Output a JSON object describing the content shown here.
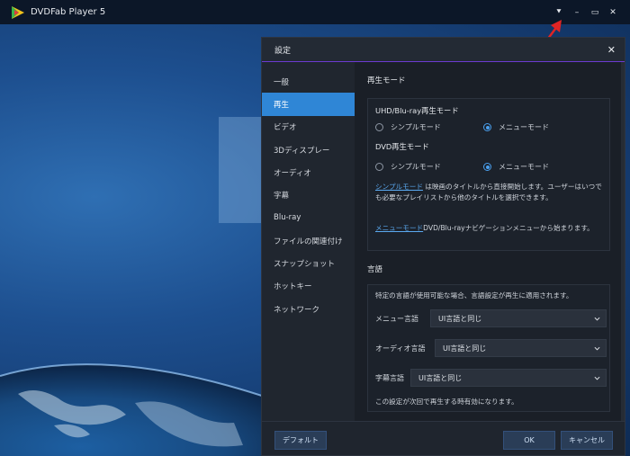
{
  "app": {
    "title": "DVDFab Player 5"
  },
  "window_controls": {
    "menu": "⯆",
    "minimize": "–",
    "maximize": "▭",
    "close": "✕"
  },
  "dialog": {
    "title": "設定",
    "close": "✕",
    "nav": [
      {
        "label": "一般"
      },
      {
        "label": "再生"
      },
      {
        "label": "ビデオ"
      },
      {
        "label": "3Dディスプレー"
      },
      {
        "label": "オーディオ"
      },
      {
        "label": "字幕"
      },
      {
        "label": "Blu-ray"
      },
      {
        "label": "ファイルの関連付け"
      },
      {
        "label": "スナップショット"
      },
      {
        "label": "ホットキー"
      },
      {
        "label": "ネットワーク"
      }
    ],
    "active_nav": "再生",
    "playback_mode": {
      "title": "再生モード",
      "uhd": {
        "title": "UHD/Blu-ray再生モード",
        "options": [
          "シンプルモード",
          "メニューモード"
        ],
        "selected": "メニューモード"
      },
      "dvd": {
        "title": "DVD再生モード",
        "options": [
          "シンプルモード",
          "メニューモード"
        ],
        "selected": "メニューモード"
      },
      "simple_link": "シンプルモード",
      "simple_desc": " は映画のタイトルから直接開始します。ユーザーはいつでも必要なプレイリストから他のタイトルを選択できます。",
      "menu_link": "メニューモード",
      "menu_desc": "DVD/Blu-rayナビゲーションメニューから始まります。"
    },
    "language": {
      "title": "言語",
      "intro": "特定の言語が使用可能な場合、言語設定が再生に適用されます。",
      "rows": [
        {
          "label": "メニュー言語",
          "value": "UI言語と同じ"
        },
        {
          "label": "オーディオ言語",
          "value": "UI言語と同じ"
        },
        {
          "label": "字幕言語",
          "value": "UI言語と同じ"
        }
      ],
      "note": "この設定が次回で再生する時有効になります。"
    },
    "footer": {
      "default": "デフォルト",
      "ok": "OK",
      "cancel": "キャンセル"
    }
  },
  "colors": {
    "accent": "#2f86d6",
    "link": "#5aa9f0",
    "header_line": "#6c3ad1",
    "annotation_arrow": "#e02424"
  }
}
